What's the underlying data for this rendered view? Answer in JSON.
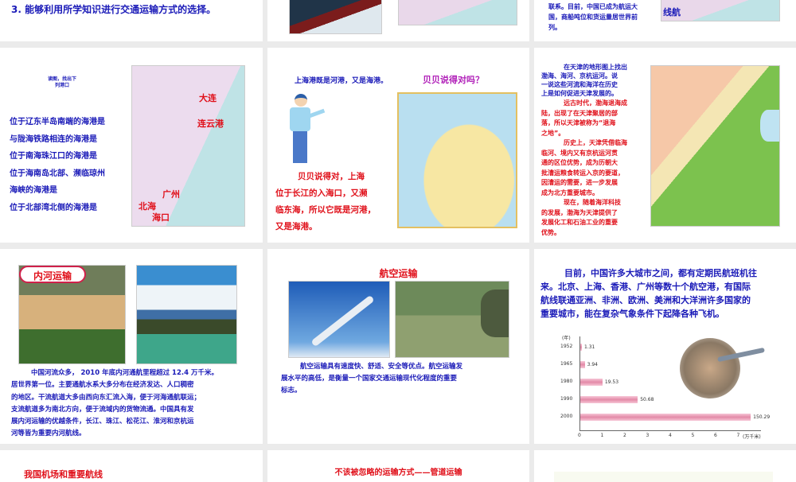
{
  "slides": [
    {
      "objective": "3. 能够利用所学知识进行交通运输方式的选择。"
    },
    {},
    {
      "lines": [
        "联系。目前，中国已成为航运大",
        "国，商船吨位和货运量居世界前",
        "列。"
      ],
      "map_label": "线航"
    },
    {
      "instruction": "读图，找出下列港口",
      "questions": [
        "位于辽东半岛南端的海港是",
        "与陇海铁路相连的海港是",
        "位于南海珠江口的海港是",
        "位于海南岛北部、濒临琼州",
        "海峡的海港是",
        "位于北部湾北侧的海港是"
      ],
      "map_labels": [
        "大连",
        "连云港",
        "广州",
        "北海",
        "海口"
      ]
    },
    {
      "statement": "上海港既是河港，又是海港。",
      "question": "贝贝说得对吗？",
      "answer": [
        "贝贝说得对，上海",
        "位于长江的入海口，又濒",
        "临东海，所以它既是河港，",
        "又是海港。"
      ]
    },
    {
      "prompt": [
        "在天津的地形图上找出",
        "渤海、海河、京杭运河。说",
        "一说这些河流和海洋在历史",
        "上是如何促进天津发展的。"
      ],
      "answer": [
        "远古时代，渤海退海成",
        "陆，出现了在天津聚居的部",
        "落，所以天津被称为“退海",
        "之地”。",
        "历史上，天津凭借临海",
        "临河、境内又有京杭运河贯",
        "通的区位优势，成为历朝大",
        "批漕运粮食转运入京的要道，",
        "因漕运的需要，进一步发展",
        "成为北方重要城市。",
        "现在，随着海洋科技",
        "的发展，渤海为天津提供了",
        "发展化工和石油工业的重要",
        "优势。"
      ]
    },
    {
      "badge": "内河运输",
      "text": [
        "中国河流众多， 2010 年底内河通航里程超过 12.4 万千米。",
        "居世界第一位。主要通航水系大多分布在经济发达、人口稠密",
        "的地区。干流航道大多由西向东汇流入海，便于河海通航联运；",
        "支流航道多为南北方向，便于流域内的货物流通。中国具有发",
        "展内河运输的优越条件，长江、珠江、松花江、淮河和京杭运",
        "河等皆为重要内河航线。"
      ]
    },
    {
      "title": "航空运输",
      "text": [
        "航空运输具有速度快、舒适、安全等优点。航空运输发",
        "展水平的高低，是衡量一个国家交通运输现代化程度的重要",
        "标志。"
      ]
    },
    {
      "text": [
        "目前，中国许多大城市之间，都有定期民航班机往",
        "来。北京、上海、香港、广州等数十个航空港，有国际",
        "航线联通亚洲、非洲、欧洲、美洲和大洋洲许多国家的",
        "重要城市，能在复杂气象条件下起降各种飞机。"
      ]
    },
    {
      "title": "我国机场和重要航线"
    },
    {
      "title": "不该被忽略的运输方式——管道运输"
    },
    {}
  ],
  "chart_data": {
    "type": "bar",
    "orientation": "horizontal",
    "categories": [
      "1952",
      "1965",
      "1980",
      "1990",
      "2000"
    ],
    "values": [
      1.31,
      3.94,
      19.53,
      50.68,
      150.29
    ],
    "value_labels": [
      "1.31",
      "3.94",
      "19.53",
      "50.68",
      "150.29"
    ],
    "ylabel": "(年)",
    "xlabel": "(万千米)",
    "xticks": [
      "0",
      "1",
      "2",
      "3",
      "4",
      "5",
      "6",
      "7"
    ],
    "bar_color": "#e38aa8"
  }
}
